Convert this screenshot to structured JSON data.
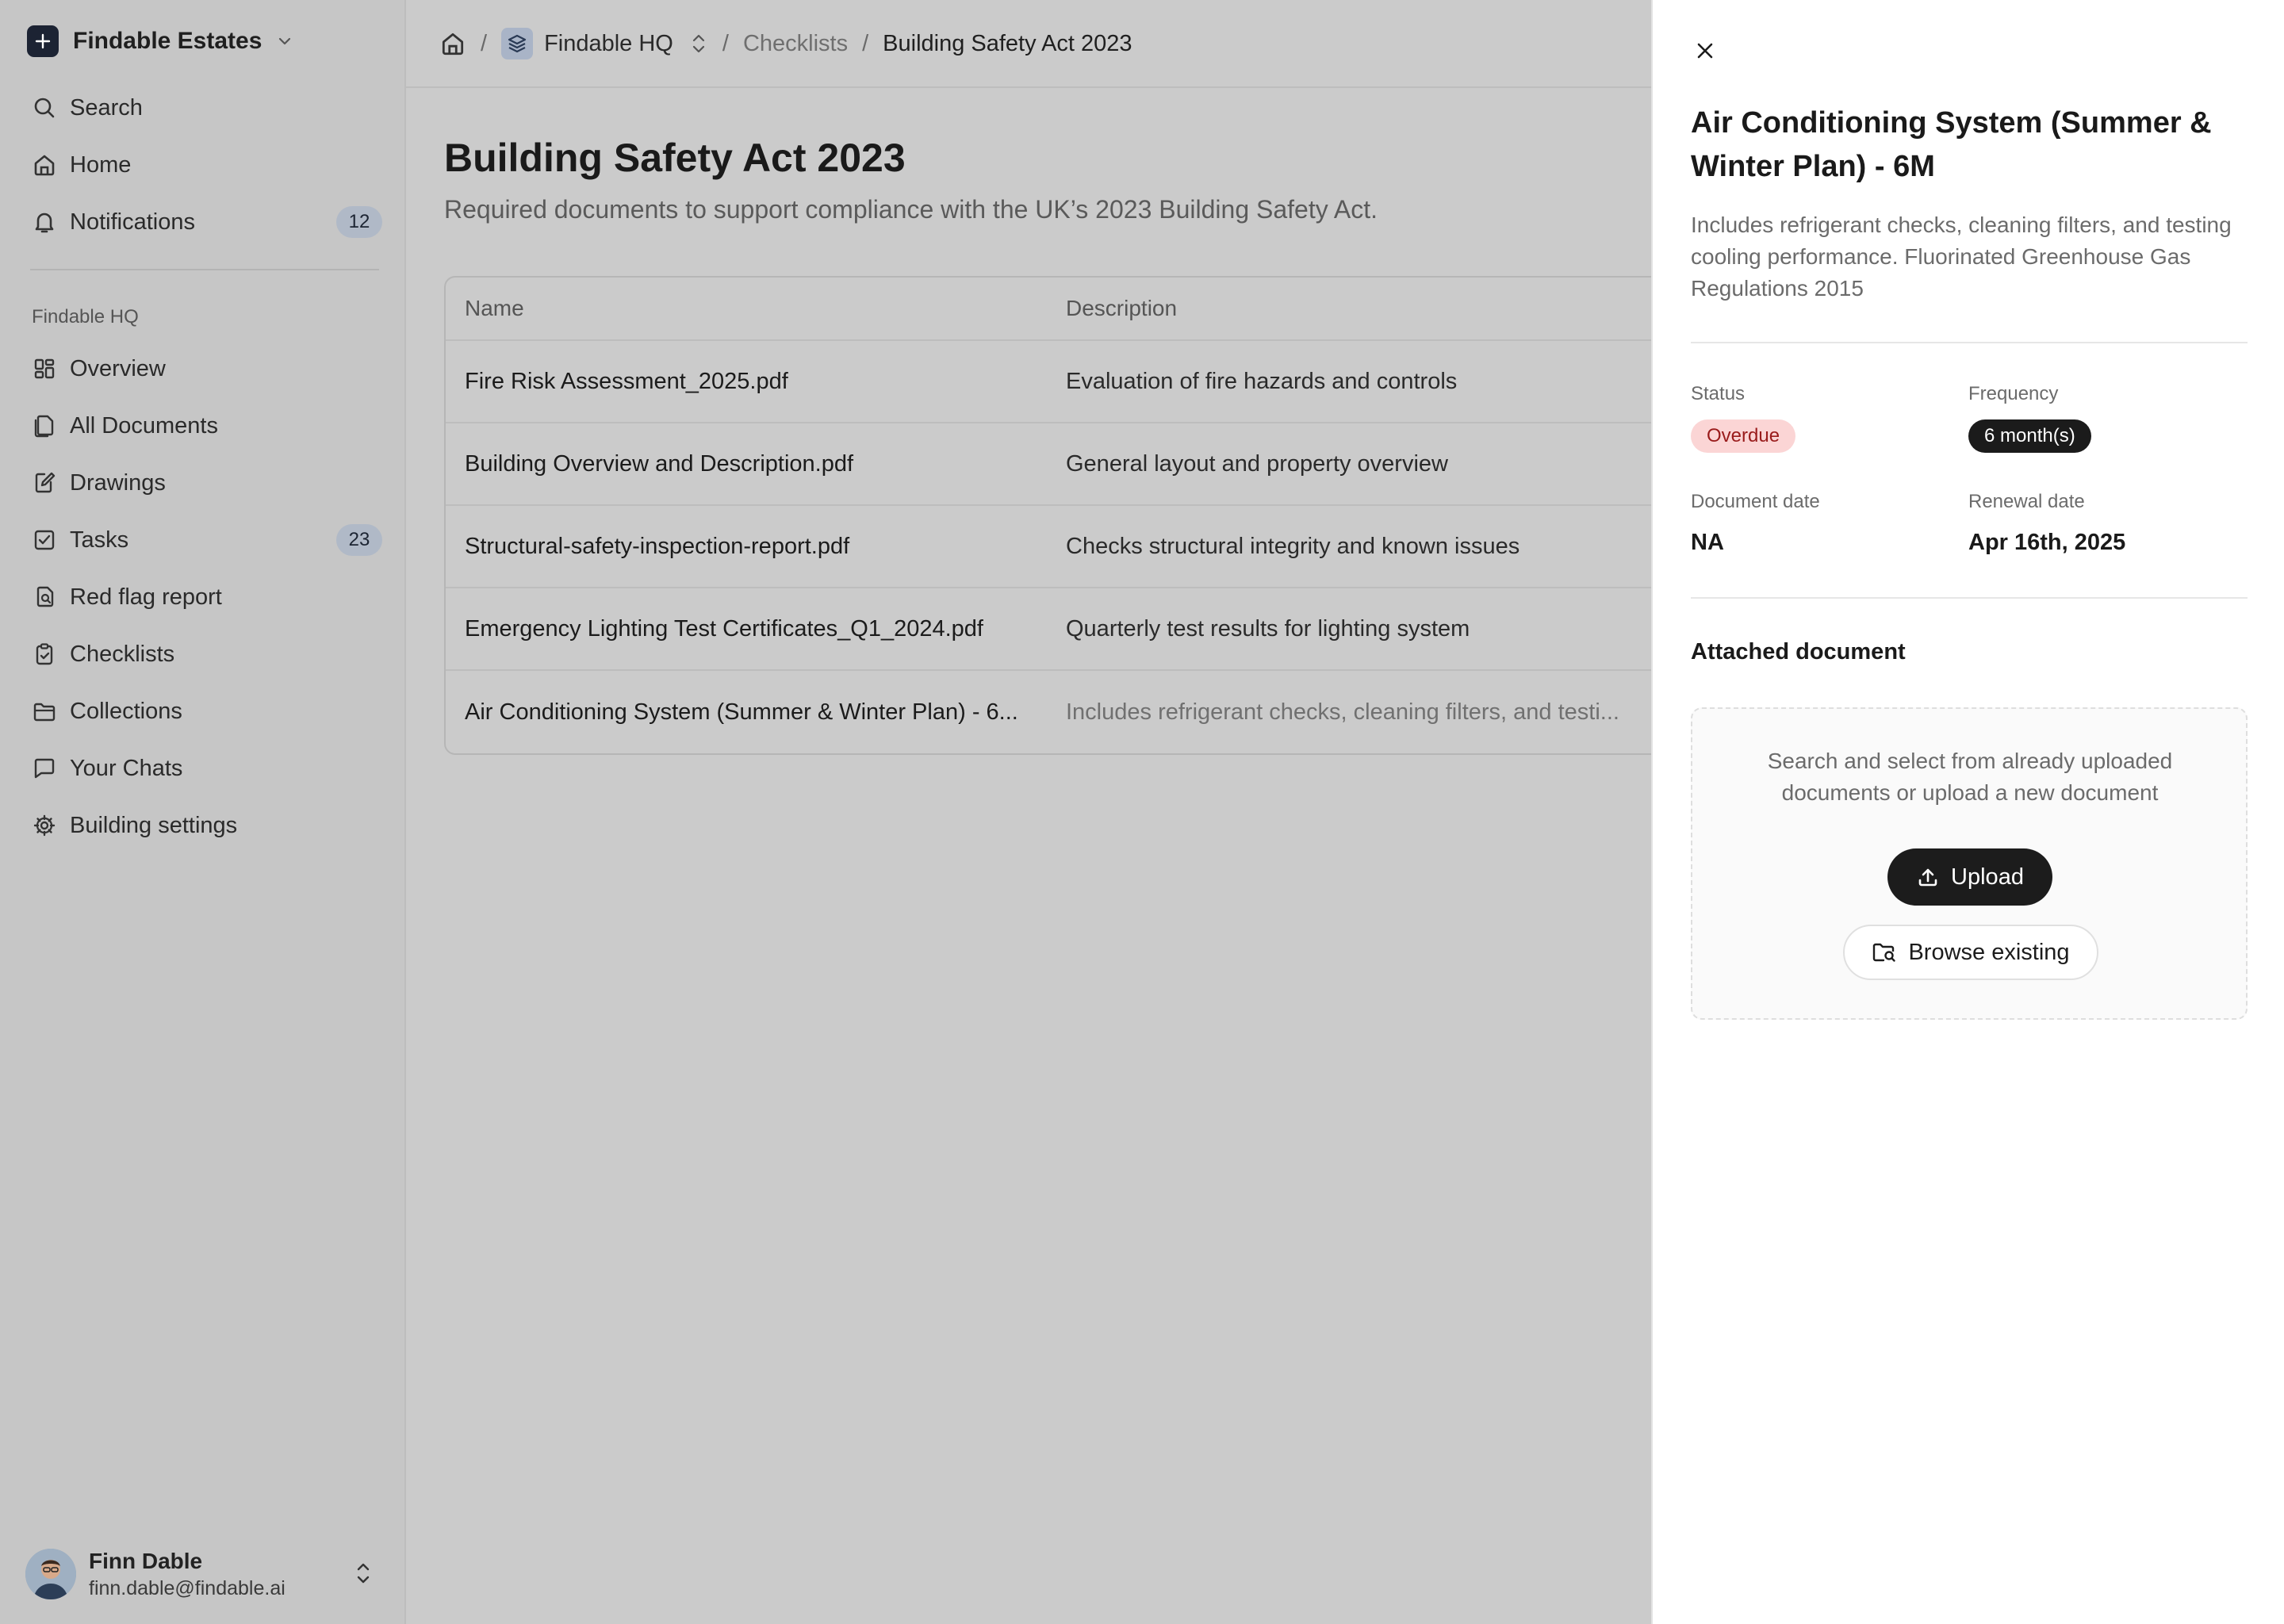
{
  "sidebar": {
    "org_name": "Findable Estates",
    "nav_top": [
      {
        "label": "Search",
        "icon": "search-icon"
      },
      {
        "label": "Home",
        "icon": "home-icon"
      },
      {
        "label": "Notifications",
        "icon": "bell-icon",
        "badge": "12"
      }
    ],
    "section_label": "Findable HQ",
    "nav_building": [
      {
        "label": "Overview",
        "icon": "overview-icon"
      },
      {
        "label": "All Documents",
        "icon": "documents-icon"
      },
      {
        "label": "Drawings",
        "icon": "drawings-icon"
      },
      {
        "label": "Tasks",
        "icon": "tasks-icon",
        "badge": "23"
      },
      {
        "label": "Red flag report",
        "icon": "red-flag-report-icon"
      },
      {
        "label": "Checklists",
        "icon": "checklist-icon"
      },
      {
        "label": "Collections",
        "icon": "folder-icon"
      },
      {
        "label": "Your Chats",
        "icon": "chat-icon"
      },
      {
        "label": "Building settings",
        "icon": "gear-icon"
      }
    ],
    "user": {
      "name": "Finn Dable",
      "email": "finn.dable@findable.ai"
    }
  },
  "breadcrumb": {
    "separator": "/",
    "workspace": "Findable HQ",
    "section": "Checklists",
    "current": "Building Safety Act 2023"
  },
  "page": {
    "title": "Building Safety Act 2023",
    "subtitle": "Required documents to support compliance with the UK’s 2023 Building Safety Act."
  },
  "table": {
    "headers": {
      "name": "Name",
      "description": "Description"
    },
    "rows": [
      {
        "name": "Fire Risk Assessment_2025.pdf",
        "description": "Evaluation of fire hazards and controls"
      },
      {
        "name": "Building Overview and Description.pdf",
        "description": "General layout and property overview"
      },
      {
        "name": "Structural-safety-inspection-report.pdf",
        "description": "Checks structural integrity and known issues"
      },
      {
        "name": "Emergency Lighting Test Certificates_Q1_2024.pdf",
        "description": "Quarterly test results for lighting system"
      },
      {
        "name": "Air Conditioning System (Summer & Winter Plan) - 6...",
        "description": "Includes refrigerant checks, cleaning filters, and testi..."
      }
    ]
  },
  "panel": {
    "title": "Air Conditioning System (Summer & Winter Plan) - 6M",
    "description": "Includes refrigerant checks, cleaning filters, and testing cooling performance. Fluorinated Greenhouse Gas Regulations 2015",
    "status_label": "Status",
    "status_value": "Overdue",
    "frequency_label": "Frequency",
    "frequency_value": "6 month(s)",
    "document_date_label": "Document date",
    "document_date_value": "NA",
    "renewal_date_label": "Renewal date",
    "renewal_date_value": "Apr 16th, 2025",
    "attached_heading": "Attached document",
    "dropzone_text": "Search and select from already uploaded documents or upload a new document",
    "upload_label": "Upload",
    "browse_label": "Browse existing"
  },
  "colors": {
    "overdue_bg": "#fbd5d5",
    "overdue_text": "#991b1b",
    "badge_bg": "#b0b9c7",
    "primary_button": "#1c1c1c"
  }
}
